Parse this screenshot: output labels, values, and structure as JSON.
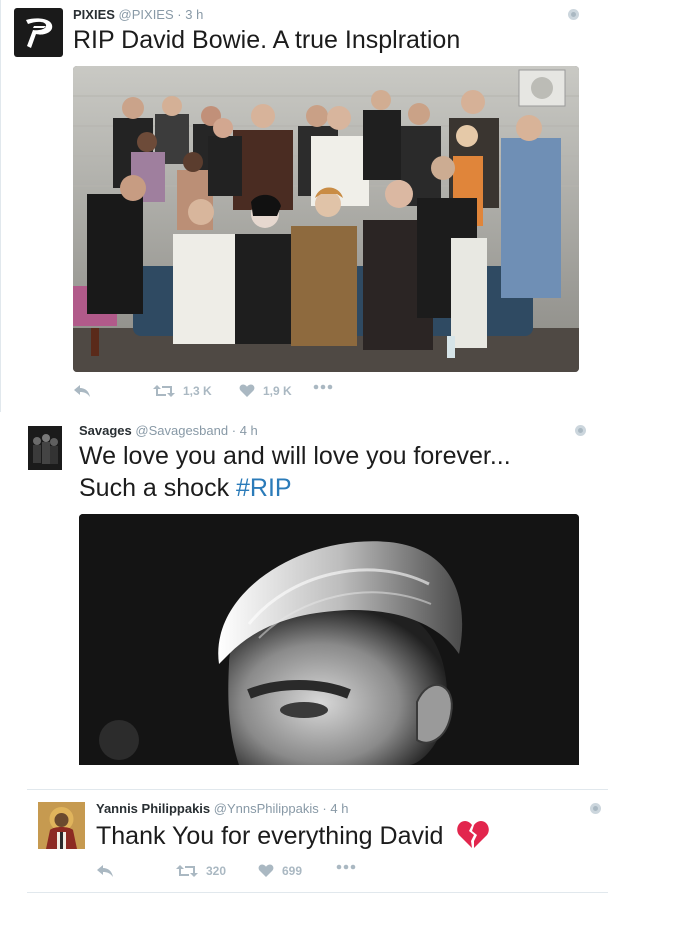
{
  "tweets": [
    {
      "name": "PIXIES",
      "handle": "@PIXIES",
      "separator": "·",
      "time": "3 h",
      "text": "RIP David Bowie. A true Insplration",
      "avatar_icon": "pixies-logo-icon",
      "media": "group-photo",
      "retweets": "1,3 K",
      "likes": "1,9 K"
    },
    {
      "name": "Savages",
      "handle": "@Savagesband",
      "separator": "·",
      "time": "4 h",
      "text_line1": "We love you and will love you forever...",
      "text_line2": "Such a shock ",
      "hashtag": "#RIP",
      "avatar_icon": "savages-band-avatar",
      "media": "bowie-portrait-photo"
    },
    {
      "name": "Yannis Philippakis",
      "handle": "@YnnsPhilippakis",
      "separator": "·",
      "time": "4 h",
      "text": "Thank You for everything David",
      "emoji_icon": "broken-heart-icon",
      "avatar_icon": "icon-painting-avatar",
      "retweets": "320",
      "likes": "699"
    }
  ],
  "colors": {
    "meta_gray": "#8899a6",
    "action_gray": "#aab8c2",
    "hashtag_blue": "#2b7bb9",
    "broken_heart": "#e2264d"
  }
}
